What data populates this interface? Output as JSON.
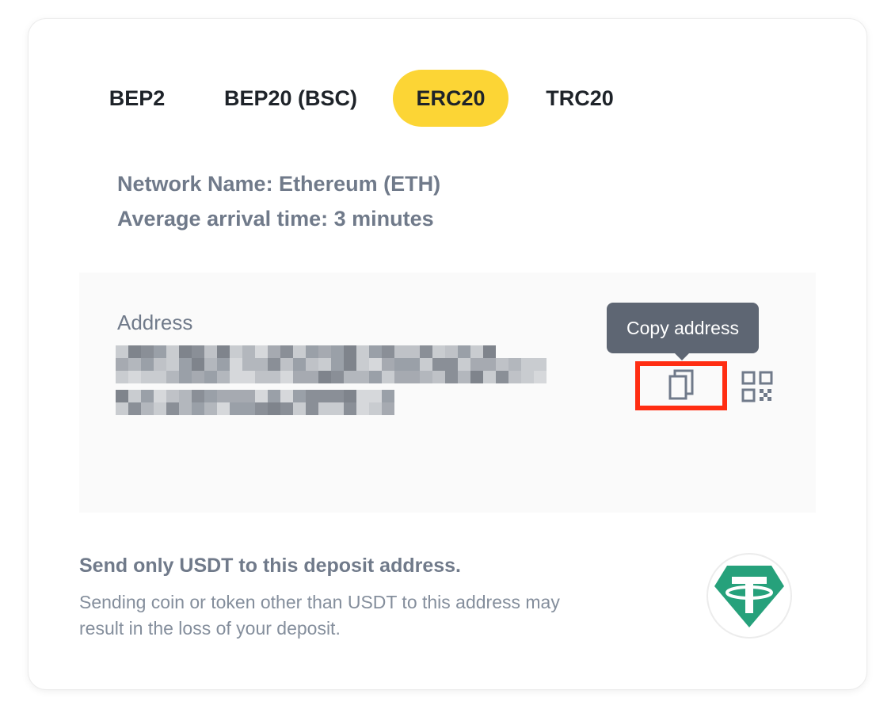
{
  "tabs": [
    {
      "label": "BEP2",
      "active": false
    },
    {
      "label": "BEP20 (BSC)",
      "active": false
    },
    {
      "label": "ERC20",
      "active": true
    },
    {
      "label": "TRC20",
      "active": false
    }
  ],
  "network": {
    "name_line": "Network Name: Ethereum (ETH)",
    "arrival_line": "Average arrival time: 3 minutes"
  },
  "address": {
    "label": "Address",
    "copy_tooltip": "Copy address"
  },
  "warning": {
    "title": "Send only USDT to this deposit address.",
    "text": "Sending coin or token other than USDT to this address may result in the loss of your deposit."
  },
  "colors": {
    "active_tab": "#fcd535",
    "highlight_box": "#ff2d12",
    "tether_green": "#26a17b",
    "tooltip_bg": "#5e6673"
  },
  "icons": {
    "copy": "copy-icon",
    "qr": "qr-code-icon",
    "logo": "tether-logo-icon"
  }
}
